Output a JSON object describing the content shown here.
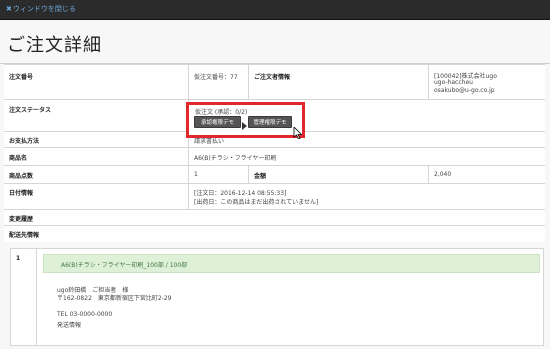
{
  "topbar": {
    "close_label": "ウィンドウを閉じる",
    "close_icon": "x-icon"
  },
  "page": {
    "title": "ご注文詳細"
  },
  "order": {
    "number_label": "注文番号",
    "number_value": "仮注文番号：77",
    "customer_label": "ご注文者情報",
    "customer_lines": [
      "[100042]株式会社ugo",
      "ugo-haccheu",
      "osakubo@u-go.co.jp"
    ],
    "status_label": "注文ステータス",
    "status_value": "仮注文 (承認：0/2)",
    "btn_approve": "承認権限デモ",
    "btn_manage": "管理権限デモ",
    "payment_label": "お支払方法",
    "payment_value": "請求書払い",
    "product_label": "商品名",
    "product_value": "A6(B)チラシ・フライヤー印刷",
    "qty_label": "商品点数",
    "qty_value": "1",
    "amount_label": "金額",
    "amount_value": "2,040",
    "date_label": "日付情報",
    "date_line1": "[注文日：2016-12-14 08:55:33]",
    "date_line2": "[出荷日：この商品はまだ出荷されていません]",
    "history_label": "変更履歴",
    "shipping_label": "配送先情報"
  },
  "shipping": {
    "index": "1",
    "product_line": "A6(B)チラシ・フライヤー印刷_100部 / 100部",
    "name": "ugo鈴田橋　ご担当者　様",
    "address": "〒162-0822　東京都新宿区下宮比町2-29",
    "tel": "TEL 03-0000-0000",
    "ship_info": "発送情報"
  }
}
